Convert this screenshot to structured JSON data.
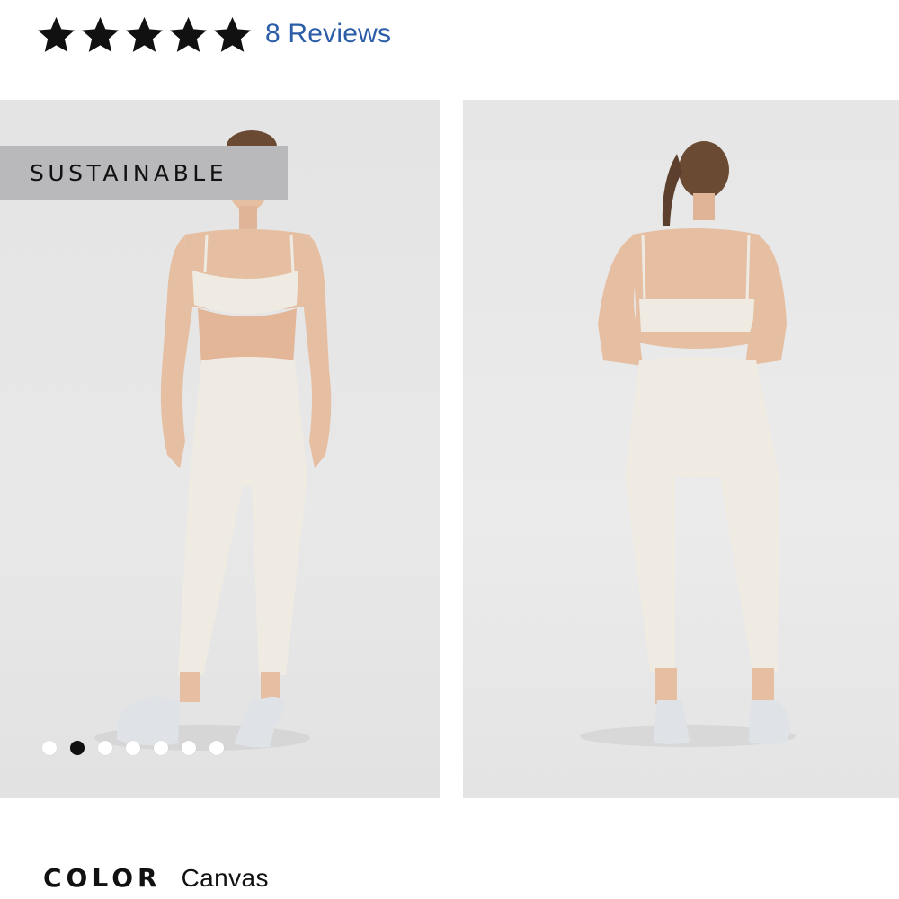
{
  "rating": {
    "stars": 5,
    "max_stars": 5,
    "reviews_label": "8 Reviews"
  },
  "gallery": {
    "badge": "SUSTAINABLE",
    "dots_total": 7,
    "active_dot": 2,
    "images": [
      {
        "view": "front",
        "description_icon": "model-front-image"
      },
      {
        "view": "back",
        "description_icon": "model-back-image"
      }
    ]
  },
  "color": {
    "label": "COLOR",
    "value": "Canvas"
  },
  "colors": {
    "link": "#2c5ea8",
    "star": "#111111",
    "badge_bg": "#b9b9bb",
    "garment": "#efebe2",
    "skin": "#e6bfa2"
  }
}
